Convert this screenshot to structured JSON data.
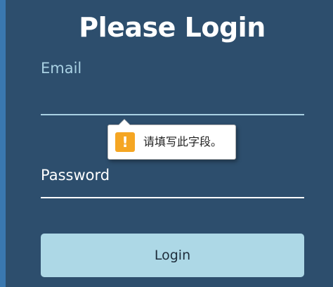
{
  "page": {
    "title": "Please Login"
  },
  "form": {
    "email_label": "Email",
    "email_value": "",
    "password_label": "Password",
    "password_value": "",
    "login_label": "Login"
  },
  "validation": {
    "message": "请填写此字段。",
    "icon": "warning-icon",
    "icon_glyph": "!"
  },
  "colors": {
    "background": "#2d4e6d",
    "accent_stripe": "#3a78b0",
    "email_label": "#a9d1e3",
    "button": "#add8e6",
    "warning": "#f5a623"
  }
}
